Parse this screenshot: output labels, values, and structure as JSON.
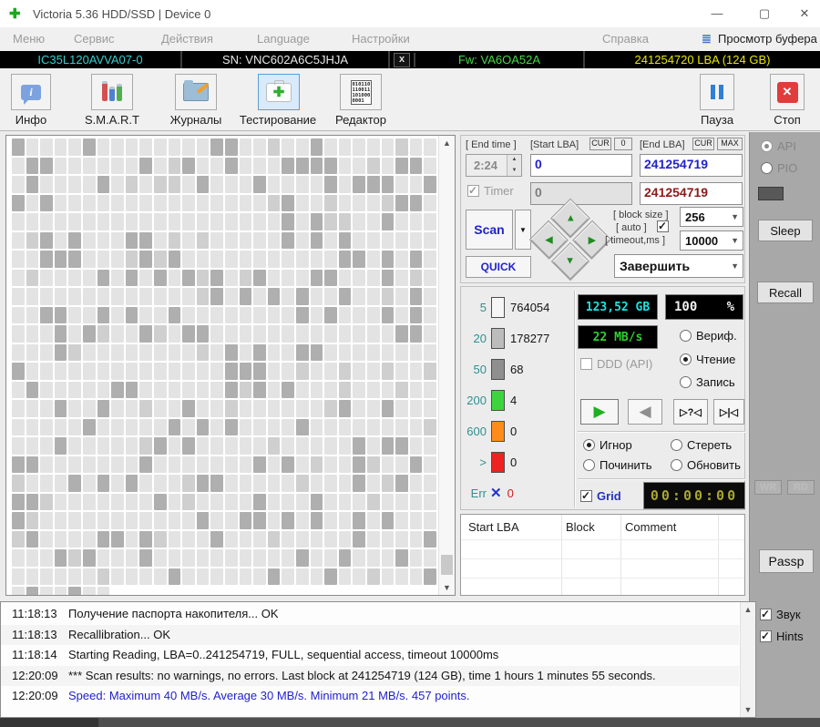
{
  "window": {
    "title": "Victoria 5.36 HDD/SSD | Device 0",
    "minimize": "—",
    "maximize": "▢",
    "close": "✕"
  },
  "menu": {
    "items": [
      "Меню",
      "Сервис",
      "Действия",
      "Language",
      "Настройки"
    ],
    "help": "Справка",
    "buffer_icon": "≣",
    "buffer_view": "Просмотр буфера"
  },
  "device_bar": {
    "model": "IC35L120AVVA07-0",
    "serial": "SN: VNC602A6C5JHJA",
    "close_btn": "x",
    "firmware": "Fw: VA6OA52A",
    "capacity": "241254720 LBA (124 GB)",
    "model_color": "#35cfcf",
    "serial_color": "#e8e8e8",
    "firmware_color": "#46d946",
    "capacity_color": "#e6e600"
  },
  "toolbar": {
    "items": [
      {
        "label": "Инфо"
      },
      {
        "label": "S.M.A.R.T"
      },
      {
        "label": "Журналы"
      },
      {
        "label": "Тестирование",
        "selected": true
      },
      {
        "label": "Редактор",
        "icon_text": "010110\n110011\n101000\n0001"
      }
    ],
    "info_icon_glyph": "i",
    "testing_icon_glyph": "✚",
    "stop_icon_glyph": "✕",
    "pause": "Пауза",
    "stop": "Стоп"
  },
  "scan_panel": {
    "end_time_label": "[ End time ]",
    "end_time_value": "2:24",
    "start_lba_label": "[Start LBA]",
    "cur_label": "CUR",
    "zero_label": "0",
    "end_lba_label": "[End LBA]",
    "max_label": "MAX",
    "start_lba_value": "0",
    "end_lba_value": "241254719",
    "start_lba_value2": "0",
    "end_lba_value2": "241254719",
    "timer_label": "Timer",
    "scan_label": "Scan",
    "scan_dd": "▼",
    "quick_label": "QUICK",
    "block_size_label": "[ block size ]",
    "block_size_value": "256",
    "auto_label": "[ auto ]",
    "timeout_label": "[ timeout,ms ]",
    "timeout_value": "10000",
    "finish_value": "Завершить",
    "arrows": {
      "up": "▲",
      "right": "▶",
      "left": "◀",
      "down": "▼"
    }
  },
  "stats": {
    "rows": [
      {
        "label": "5",
        "value": "764054",
        "color": "#f6f6f6"
      },
      {
        "label": "20",
        "value": "178277",
        "color": "#bcbcbc"
      },
      {
        "label": "50",
        "value": "68",
        "color": "#8f8f8f"
      },
      {
        "label": "200",
        "value": "4",
        "color": "#3ed43e"
      },
      {
        "label": "600",
        "value": "0",
        "color": "#ff8c1a"
      },
      {
        "label": ">",
        "value": "0",
        "color": "#ee2222"
      },
      {
        "label": "Err",
        "value": "0",
        "color": "#2233cc",
        "err_icon": true,
        "value_color": "#cc2222"
      }
    ]
  },
  "monitor": {
    "gb_display": "123,52 GB",
    "gb_color": "#1de2e2",
    "percent_value": "100",
    "percent_sign": "%",
    "percent_color": "#f2f2f2",
    "speed_display": "22 MB/s",
    "speed_color": "#2bd42b",
    "ddd_label": "DDD (API)",
    "modes": [
      {
        "label": "Вериф.",
        "selected": false
      },
      {
        "label": "Чтение",
        "selected": true
      },
      {
        "label": "Запись",
        "selected": false
      }
    ],
    "play_glyph": "▶",
    "back_glyph": "◀",
    "skip_btn": "▷?◁",
    "end_btn": "▷|◁",
    "actions": [
      {
        "label": "Игнор",
        "selected": true
      },
      {
        "label": "Стереть",
        "selected": false
      },
      {
        "label": "Починить",
        "selected": false
      },
      {
        "label": "Обновить",
        "selected": false
      }
    ],
    "grid_label": "Grid",
    "grid_checked": true,
    "clock_display": "00:00:00",
    "clock_color": "#a3a32a"
  },
  "defect_table": {
    "columns": [
      "Start LBA",
      "Block",
      "Comment"
    ]
  },
  "sidebar": {
    "api": "API",
    "pio": "PIO",
    "sleep": "Sleep",
    "recall": "Recall",
    "wr": "WR",
    "rd": "RD",
    "passp": "Passp",
    "sound": "Звук",
    "hints": "Hints"
  },
  "log": {
    "entries": [
      {
        "time": "11:18:13",
        "text": "Получение паспорта накопителя... OK"
      },
      {
        "time": "11:18:13",
        "text": "Recallibration... OK"
      },
      {
        "time": "11:18:14",
        "text": "Starting Reading, LBA=0..241254719, FULL, sequential access, timeout 10000ms"
      },
      {
        "time": "12:20:09",
        "text": "*** Scan results: no warnings, no errors. Last block at 241254719 (124 GB), time 1 hours 1 minutes 55 seconds."
      },
      {
        "time": "12:20:09",
        "text": "Speed: Maximum 40 MB/s. Average 30 MB/s. Minimum 21 MB/s. 457 points.",
        "color": "#2222cc"
      }
    ]
  },
  "blockmap": {
    "cols": 30,
    "rows": 24,
    "partial_cells": 7,
    "seed": 911,
    "dark_ratio": 0.2,
    "mid_ratio": 0.07,
    "light_color": "#e3e3e3",
    "mid_color": "#cfcfcf",
    "dark_color": "#afafaf"
  }
}
